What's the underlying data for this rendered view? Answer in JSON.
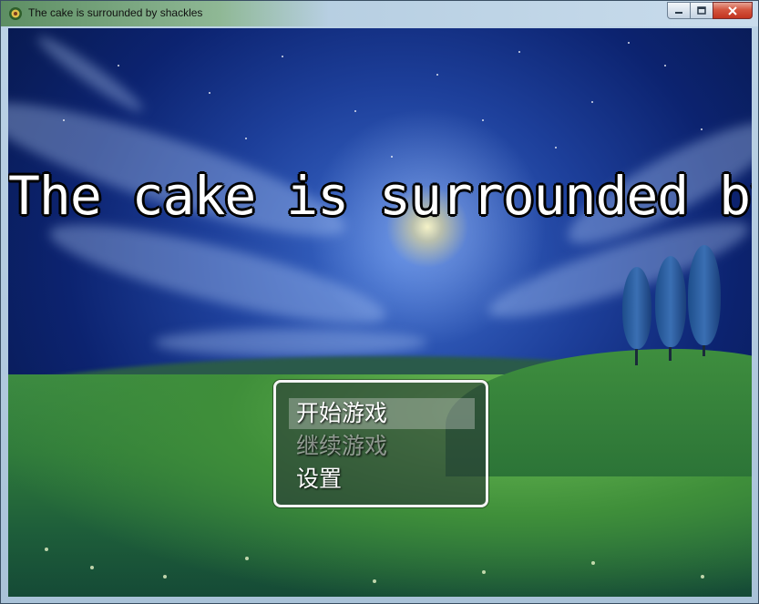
{
  "window": {
    "title": "The cake is surrounded by shackles",
    "icon": "game-app-icon",
    "controls": [
      "minimize-icon",
      "maximize-icon",
      "close-icon"
    ]
  },
  "game": {
    "title": "The cake is surrounded by shackles"
  },
  "menu": {
    "items": [
      {
        "label": "开始游戏",
        "state": "selected"
      },
      {
        "label": "继续游戏",
        "state": "disabled"
      },
      {
        "label": "设置",
        "state": "enabled"
      }
    ]
  },
  "colors": {
    "title_text": "#ffffff",
    "title_outline": "#000000",
    "menu_border": "#f4f4f4",
    "disabled_text": "#a0a0a0"
  }
}
